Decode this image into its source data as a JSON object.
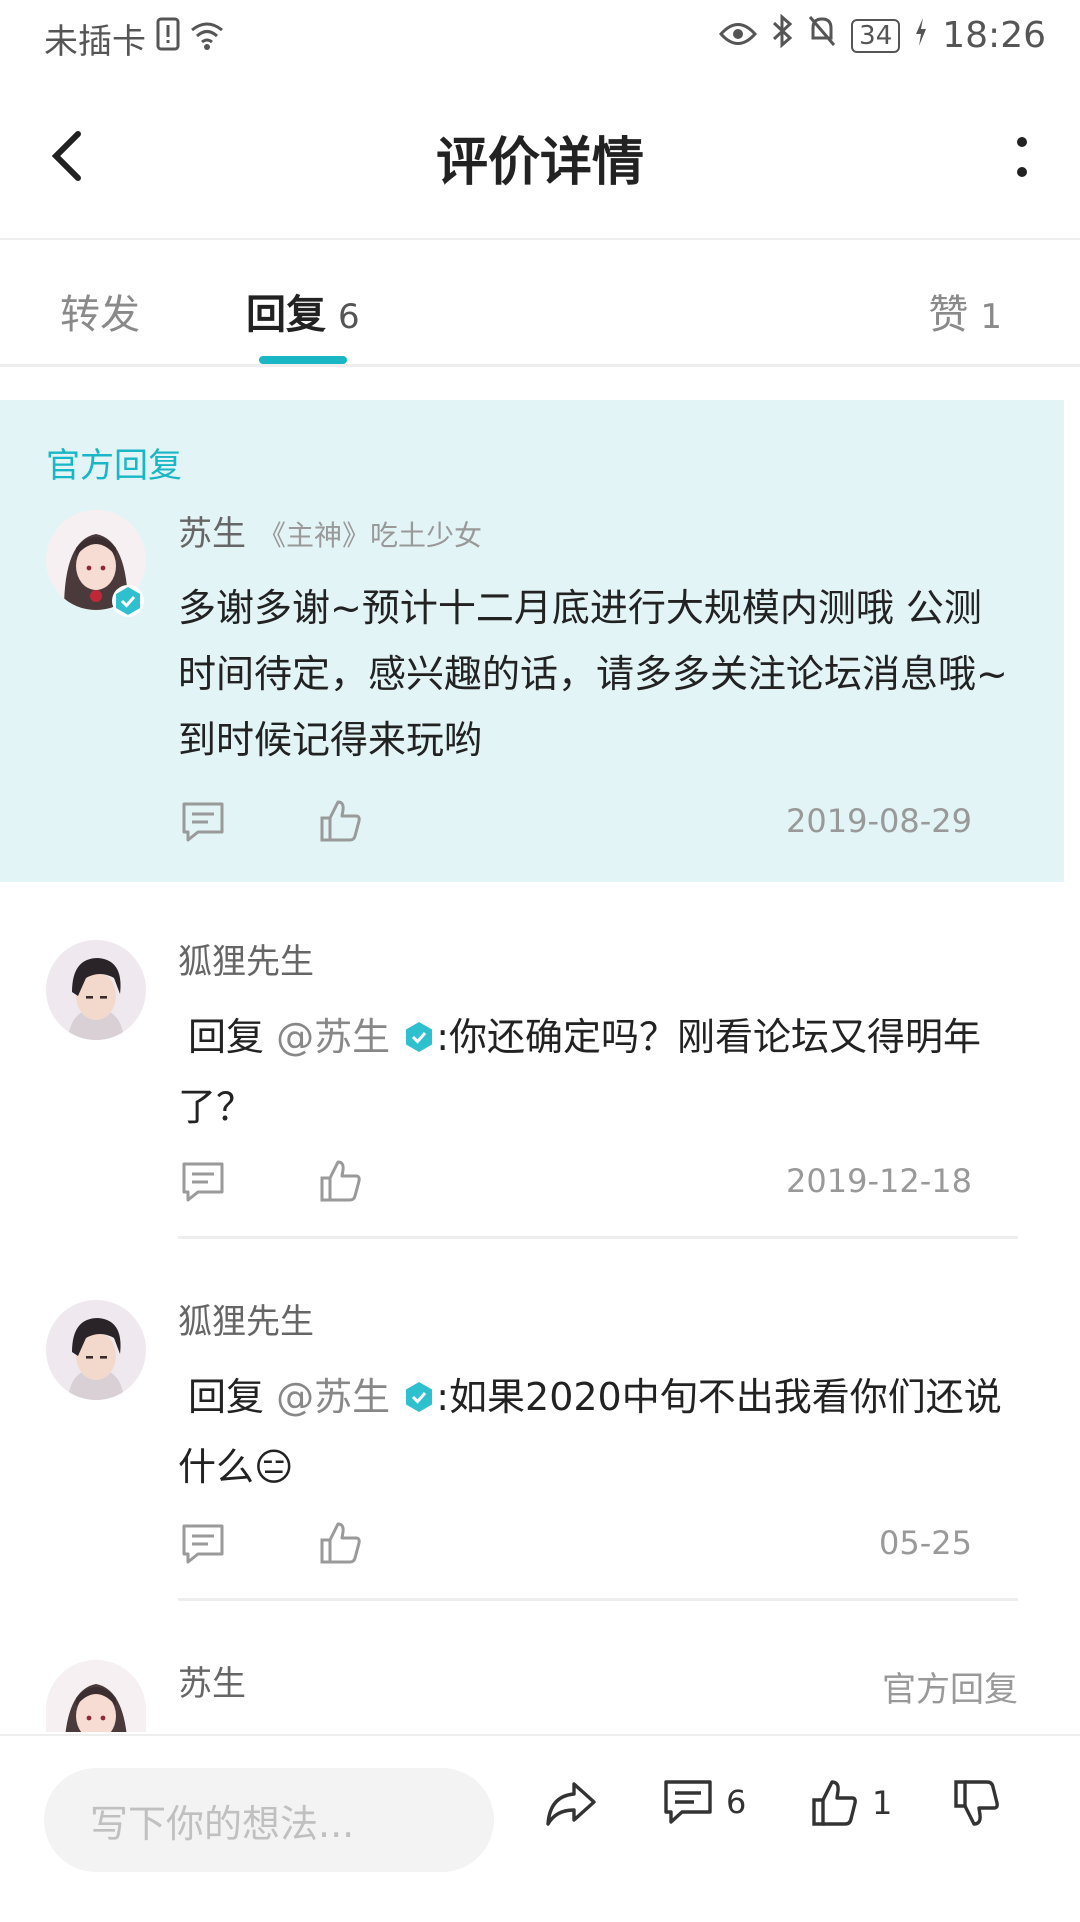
{
  "status": {
    "carrier": "未插卡",
    "battery": "34",
    "time": "18:26"
  },
  "header": {
    "title": "评价详情"
  },
  "tabs": [
    {
      "label": "转发",
      "count": ""
    },
    {
      "label": "回复",
      "count": "6"
    },
    {
      "label": "赞",
      "count": "1"
    }
  ],
  "official": {
    "label": "官方回复",
    "author": "苏生",
    "subtitle": "《主神》吃土少女",
    "content": "多谢多谢~预计十二月底进行大规模内测哦 公测时间待定，感兴趣的话，请多多关注论坛消息哦~到时候记得来玩哟",
    "date": "2019-08-29"
  },
  "replies": [
    {
      "author": "狐狸先生",
      "prefix": "回复",
      "mention": "@苏生",
      "text": ":你还确定吗？刚看论坛又得明年了？",
      "date": "2019-12-18"
    },
    {
      "author": "狐狸先生",
      "prefix": "回复",
      "mention": "@苏生",
      "text": ":如果2020中旬不出我看你们还说什么😑",
      "date": "05-25"
    },
    {
      "author": "苏生",
      "tag": "官方回复"
    }
  ],
  "bottombar": {
    "placeholder": "写下你的想法...",
    "comment_count": "6",
    "like_count": "1"
  },
  "colors": {
    "accent": "#19b6c6",
    "official_bg": "#e3f4f7"
  }
}
